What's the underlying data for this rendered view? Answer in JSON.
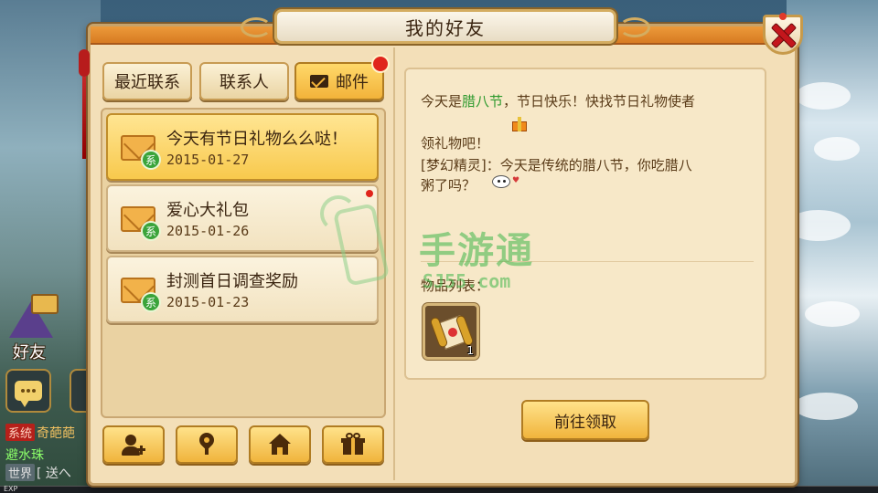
{
  "dialog": {
    "title": "我的好友",
    "tabs": [
      {
        "label": "最近联系"
      },
      {
        "label": "联系人"
      },
      {
        "label": "邮件",
        "active": true
      }
    ]
  },
  "mails": [
    {
      "title": "今天有节日礼物么么哒！",
      "date": "2015-01-27",
      "badge": "系",
      "selected": true
    },
    {
      "title": "爱心大礼包",
      "date": "2015-01-26",
      "badge": "系",
      "unread": true
    },
    {
      "title": "封测首日调查奖励",
      "date": "2015-01-23",
      "badge": "系"
    }
  ],
  "toolbar": {
    "icons": [
      "add-friend-icon",
      "location-pin-icon",
      "home-icon",
      "gift-icon"
    ]
  },
  "message": {
    "line1_pre": "今天是",
    "line1_highlight": "腊八节",
    "line1_post": "，节日快乐！快找节日礼物使者",
    "line2": "领礼物吧！",
    "line3": "[梦幻精灵]：今天是传统的腊八节，你吃腊八",
    "line4": "粥了吗？"
  },
  "items": {
    "label": "物品列表：",
    "list": [
      {
        "icon": "scroll-icon",
        "count": "1"
      }
    ]
  },
  "claim_button": "前往领取",
  "hud": {
    "friend_label": "好友",
    "chat": [
      {
        "tag": "系统",
        "text": "奇葩葩"
      },
      {
        "tag": "",
        "text": "避水珠"
      },
      {
        "tag": "世界",
        "text": "[ 送へ"
      }
    ],
    "exp_label": "EXP"
  },
  "watermark": {
    "text": "手游通",
    "url": "SJ55.com"
  },
  "colors": {
    "accent_orange": "#f0b43c",
    "highlight_green": "#2f9a2f",
    "badge_red": "#e0251b",
    "close_red": "#c4161c"
  }
}
